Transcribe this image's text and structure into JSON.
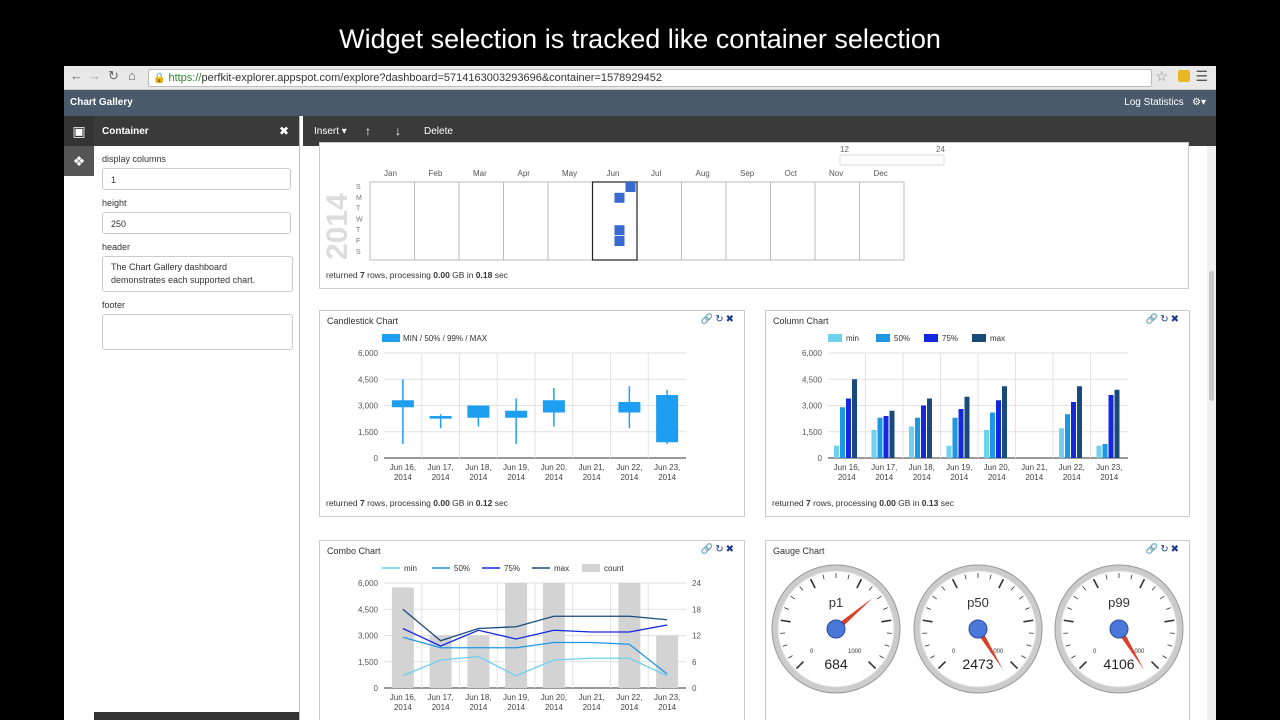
{
  "caption": "Widget selection is tracked like container selection",
  "browser": {
    "url_scheme": "https://",
    "url_rest": "perfkit-explorer.appspot.com/explore?dashboard=5714163003293696&container=1578929452"
  },
  "app": {
    "title": "Chart Gallery",
    "log_statistics": "Log Statistics",
    "settings_icon": "gear-icon"
  },
  "sidebar": {
    "title": "Container",
    "fields": [
      {
        "label": "display columns",
        "value": "1"
      },
      {
        "label": "height",
        "value": "250"
      },
      {
        "label": "header",
        "value": "The Chart Gallery dashboard demonstrates each supported chart."
      },
      {
        "label": "footer",
        "value": ""
      }
    ]
  },
  "toolbar": {
    "insert": "Insert",
    "move_up": "↑",
    "move_down": "↓",
    "delete": "Delete"
  },
  "calendar": {
    "months": [
      "Jan",
      "Feb",
      "Mar",
      "Apr",
      "May",
      "Jun",
      "Jul",
      "Aug",
      "Sep",
      "Oct",
      "Nov",
      "Dec"
    ],
    "days": [
      "S",
      "M",
      "T",
      "W",
      "T",
      "F",
      "S"
    ],
    "year": "2014",
    "scale_min": "12",
    "scale_max": "24",
    "footer": {
      "pre": "returned ",
      "rows": "7",
      "mid": " rows, processing ",
      "gb": "0.00",
      "mid2": " GB in ",
      "sec": "0.18",
      "post": " sec"
    }
  },
  "candlestick": {
    "title": "Candlestick Chart",
    "footer": {
      "pre": "returned ",
      "rows": "7",
      "mid": " rows, processing ",
      "gb": "0.00",
      "mid2": " GB in ",
      "sec": "0.12",
      "post": " sec"
    }
  },
  "column": {
    "title": "Column Chart",
    "footer": {
      "pre": "returned ",
      "rows": "7",
      "mid": " rows, processing ",
      "gb": "0.00",
      "mid2": " GB in ",
      "sec": "0.13",
      "post": " sec"
    }
  },
  "combo": {
    "title": "Combo Chart"
  },
  "gauge": {
    "title": "Gauge Chart",
    "gauges": [
      {
        "label": "p1",
        "value": 684,
        "min": "0",
        "max": "1000"
      },
      {
        "label": "p50",
        "value": 2473,
        "min": "0",
        "max": "1000"
      },
      {
        "label": "p99",
        "value": 4106,
        "min": "0",
        "max": "1000"
      }
    ]
  },
  "colors": {
    "c_min": "#6fd0f0",
    "c_50": "#1e96e6",
    "c_75": "#1428e0",
    "c_max": "#1a4a7a",
    "count": "#d3d3d3",
    "candle": "#1e9ef0",
    "calendar_cell": "#3a6ad0"
  },
  "chart_data": [
    {
      "type": "candlestick",
      "title": "Candlestick Chart",
      "categories": [
        "Jun 16, 2014",
        "Jun 17, 2014",
        "Jun 18, 2014",
        "Jun 19, 2014",
        "Jun 20, 2014",
        "Jun 21, 2014",
        "Jun 22, 2014",
        "Jun 23, 2014"
      ],
      "legend": [
        "MIN / 50% / 99% / MAX"
      ],
      "y_ticks": [
        "0",
        "1,500",
        "3,000",
        "4,500",
        "6,000"
      ],
      "ylim": [
        0,
        6000
      ],
      "candles": [
        {
          "low": 800,
          "open": 2900,
          "close": 3300,
          "high": 4500
        },
        {
          "low": 1700,
          "open": 2250,
          "close": 2400,
          "high": 2500
        },
        {
          "low": 1800,
          "open": 2300,
          "close": 3000,
          "high": 3000
        },
        {
          "low": 800,
          "open": 2300,
          "close": 2700,
          "high": 3400
        },
        {
          "low": 1800,
          "open": 2600,
          "close": 3300,
          "high": 4000
        },
        null,
        {
          "low": 1700,
          "open": 2600,
          "close": 3200,
          "high": 4100
        },
        {
          "low": 800,
          "open": 900,
          "close": 3600,
          "high": 3900
        }
      ]
    },
    {
      "type": "bar",
      "title": "Column Chart",
      "categories": [
        "Jun 16, 2014",
        "Jun 17, 2014",
        "Jun 18, 2014",
        "Jun 19, 2014",
        "Jun 20, 2014",
        "Jun 21, 2014",
        "Jun 22, 2014",
        "Jun 23, 2014"
      ],
      "y_ticks": [
        "0",
        "1,500",
        "3,000",
        "4,500",
        "6,000"
      ],
      "ylim": [
        0,
        6000
      ],
      "series": [
        {
          "name": "min",
          "values": [
            700,
            1600,
            1800,
            700,
            1600,
            0,
            1700,
            700
          ]
        },
        {
          "name": "50%",
          "values": [
            2900,
            2300,
            2300,
            2300,
            2600,
            0,
            2500,
            800
          ]
        },
        {
          "name": "75%",
          "values": [
            3400,
            2400,
            3000,
            2800,
            3300,
            0,
            3200,
            3600
          ]
        },
        {
          "name": "max",
          "values": [
            4500,
            2700,
            3400,
            3500,
            4100,
            0,
            4100,
            3900
          ]
        }
      ]
    },
    {
      "type": "line",
      "title": "Combo Chart",
      "categories": [
        "Jun 16, 2014",
        "Jun 17, 2014",
        "Jun 18, 2014",
        "Jun 19, 2014",
        "Jun 20, 2014",
        "Jun 21, 2014",
        "Jun 22, 2014",
        "Jun 23, 2014"
      ],
      "y_ticks": [
        "0",
        "1,500",
        "3,000",
        "4,500",
        "6,000"
      ],
      "y2_ticks": [
        "0",
        "6",
        "12",
        "18",
        "24"
      ],
      "ylim": [
        0,
        6000
      ],
      "y2lim": [
        0,
        24
      ],
      "series": [
        {
          "name": "min",
          "values": [
            700,
            1600,
            1800,
            700,
            1600,
            1700,
            1700,
            700
          ]
        },
        {
          "name": "50%",
          "values": [
            2900,
            2300,
            2300,
            2300,
            2600,
            2600,
            2500,
            800
          ]
        },
        {
          "name": "75%",
          "values": [
            3400,
            2400,
            3300,
            2800,
            3300,
            3200,
            3200,
            3600
          ]
        },
        {
          "name": "max",
          "values": [
            4500,
            2700,
            3400,
            3500,
            4100,
            4100,
            4100,
            3900
          ]
        },
        {
          "name": "count",
          "kind": "bar",
          "axis": "right",
          "values": [
            23,
            12,
            12,
            24,
            24,
            0,
            24,
            12
          ]
        }
      ]
    },
    {
      "type": "heatmap",
      "subtype": "calendar",
      "year": "2014",
      "cells": [
        {
          "month": "Jun",
          "week": 1,
          "day": 0
        },
        {
          "month": "Jun",
          "week": 0,
          "day": 1
        },
        {
          "month": "Jun",
          "week": 0,
          "day": 4
        },
        {
          "month": "Jun",
          "week": 0,
          "day": 5
        }
      ]
    }
  ]
}
